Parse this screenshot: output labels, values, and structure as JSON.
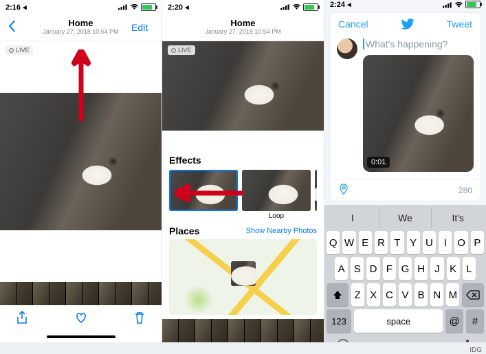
{
  "credit": "IDG",
  "screen1": {
    "time": "2:16 ◂",
    "nav": {
      "title": "Home",
      "subtitle": "January 27, 2018  10:54 PM",
      "edit": "Edit"
    },
    "live_badge": "LIVE"
  },
  "screen2": {
    "time": "2:20 ◂",
    "nav": {
      "title": "Home",
      "subtitle": "January 27, 2018  10:54 PM"
    },
    "live_badge": "LIVE",
    "effects_title": "Effects",
    "effects": [
      {
        "label": ""
      },
      {
        "label": "Loop"
      },
      {
        "label": ""
      }
    ],
    "places_title": "Places",
    "nearby_link": "Show Nearby Photos"
  },
  "screen3": {
    "time": "2:24 ◂",
    "compose": {
      "cancel": "Cancel",
      "tweet": "Tweet",
      "placeholder": "What's happening?",
      "duration": "0:01",
      "char_count": "280"
    },
    "predictions": [
      "I",
      "We",
      "It's"
    ],
    "keyboard": {
      "row1": [
        "Q",
        "W",
        "E",
        "R",
        "T",
        "Y",
        "U",
        "I",
        "O",
        "P"
      ],
      "row2": [
        "A",
        "S",
        "D",
        "F",
        "G",
        "H",
        "J",
        "K",
        "L"
      ],
      "row3": [
        "Z",
        "X",
        "C",
        "V",
        "B",
        "N",
        "M"
      ],
      "numkey": "123",
      "space": "space",
      "at": "@",
      "hash": "#"
    }
  }
}
